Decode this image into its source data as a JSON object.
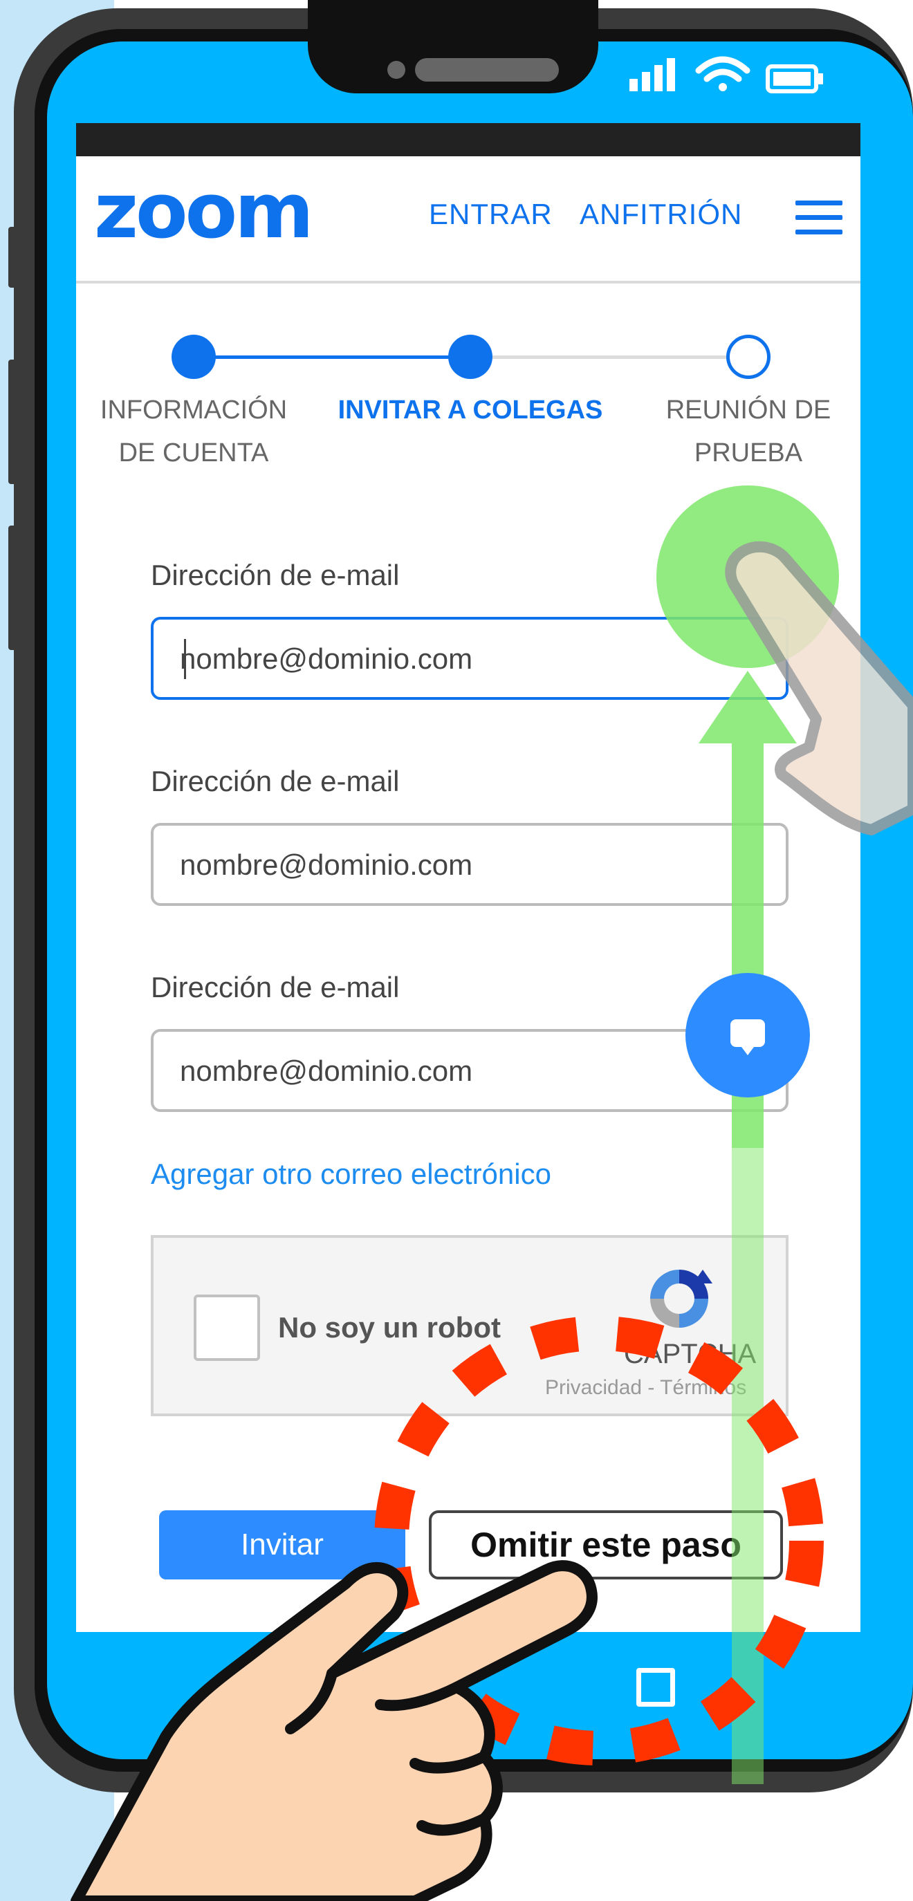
{
  "header": {
    "logo": "zoom",
    "nav": [
      "ENTRAR",
      "ANFITRIÓN"
    ]
  },
  "steps": [
    {
      "line1": "INFORMACIÓN",
      "line2": "DE CUENTA",
      "state": "done"
    },
    {
      "line1": "INVITAR A COLEGAS",
      "line2": "",
      "state": "current"
    },
    {
      "line1": "REUNIÓN DE",
      "line2": "PRUEBA",
      "state": "pending"
    }
  ],
  "form": {
    "fields": [
      {
        "label": "Dirección de e-mail",
        "placeholder": "nombre@dominio.com"
      },
      {
        "label": "Dirección de e-mail",
        "placeholder": "nombre@dominio.com"
      },
      {
        "label": "Dirección de e-mail",
        "placeholder": "nombre@dominio.com"
      }
    ],
    "add_link": "Agregar otro correo electrónico"
  },
  "captcha": {
    "label": "No soy un robot",
    "brand": "CAPTCHA",
    "links": "Privacidad - Términos"
  },
  "buttons": {
    "invite": "Invitar",
    "skip": "Omitir este paso"
  },
  "colors": {
    "brand": "#0e72ed",
    "phone_screen": "#00b4ff",
    "highlight_ring": "#ff3300",
    "swipe_arrow": "#7ee86a"
  }
}
